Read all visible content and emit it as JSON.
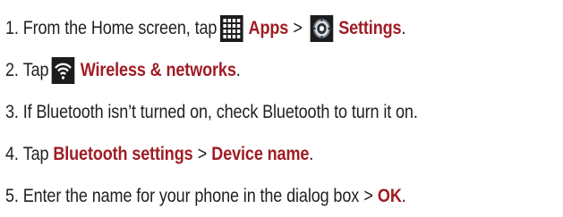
{
  "steps": [
    {
      "number": "1.",
      "text_before": "From the Home screen, tap",
      "apps_label": "Apps",
      "separator": ">",
      "settings_label": "Settings",
      "end": ".",
      "icons": [
        "apps-grid-icon",
        "settings-icon"
      ]
    },
    {
      "number": "2.",
      "text_before": "Tap",
      "wireless_label": "Wireless & networks",
      "end": ".",
      "icons": [
        "wifi-icon"
      ]
    },
    {
      "number": "3.",
      "text": "If Bluetooth isn’t turned on, check Bluetooth to turn it on."
    },
    {
      "number": "4.",
      "text_before": "Tap",
      "bt_settings_label": "Bluetooth settings",
      "separator": ">",
      "device_name_label": "Device name",
      "end": "."
    },
    {
      "number": "5.",
      "text_before": "Enter the name for your phone in the dialog box",
      "separator": ">",
      "ok_label": "OK",
      "end": "."
    }
  ],
  "colors": {
    "emphasis": "#a01c24",
    "body_text": "#231f20",
    "icon_tile": "#1c1c1c"
  }
}
